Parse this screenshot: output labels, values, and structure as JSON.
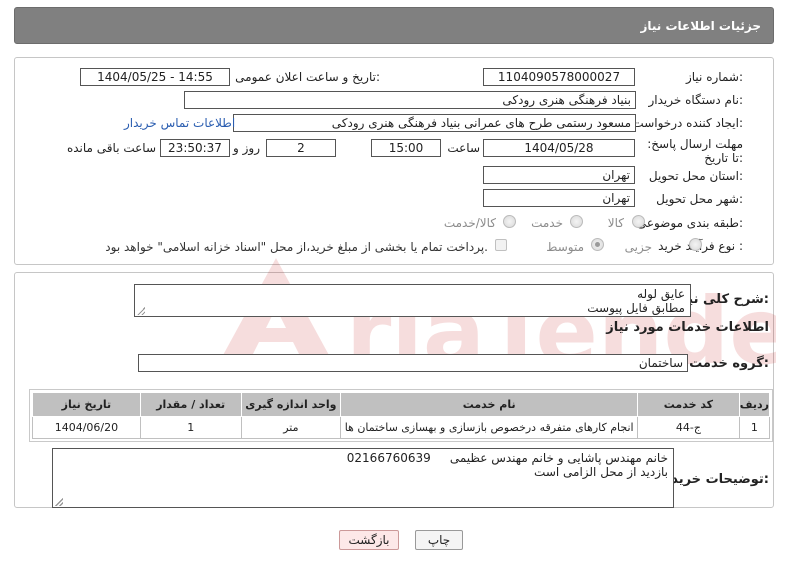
{
  "header": {
    "title": "جزئیات اطلاعات نیاز"
  },
  "form": {
    "need_number_label": "شماره نیاز:",
    "need_number": "1104090578000027",
    "announce_label": "تاریخ و ساعت اعلان عمومی:",
    "announce_value": "1404/05/25 - 14:55",
    "buyer_org_label": "نام دستگاه خریدار:",
    "buyer_org": "بنیاد فرهنگی هنری رودکی",
    "creator_label": "ایجاد کننده درخواست:",
    "creator": "مسعود رستمی طرح های عمرانی بنیاد فرهنگی هنری رودکی",
    "contact_link": "اطلاعات تماس خریدار",
    "deadline_label": "مهلت ارسال پاسخ: تا تاریخ:",
    "deadline_date": "1404/05/28",
    "time_label": "ساعت",
    "deadline_time": "15:00",
    "days_value": "2",
    "days_label": "روز و",
    "remaining_value": "23:50:37",
    "remaining_label": "ساعت باقی مانده",
    "province_label": "استان محل تحویل:",
    "province": "تهران",
    "city_label": "شهر محل تحویل:",
    "city": "تهران",
    "category_label": "طبقه بندی موضوعی:",
    "category_options": [
      "کالا",
      "خدمت",
      "کالا/خدمت"
    ],
    "process_label": "نوع فرآیند خرید :",
    "process_options": [
      "جزیی",
      "متوسط"
    ],
    "payment_note": "پرداخت تمام یا بخشی از مبلغ خرید،از محل \"اسناد خزانه اسلامی\" خواهد بود."
  },
  "summary": {
    "label": "شرح کلی نیاز:",
    "lines": [
      "عایق لوله",
      "مطابق فایل پیوست"
    ]
  },
  "services": {
    "section_title": "اطلاعات خدمات مورد نیاز",
    "group_label": "گروه خدمت:",
    "group_value": "ساختمان",
    "columns": [
      "ردیف",
      "کد خدمت",
      "نام خدمت",
      "واحد اندازه گیری",
      "تعداد / مقدار",
      "تاریخ نیاز"
    ],
    "rows": [
      [
        "1",
        "ج-44",
        "انجام کارهای متفرقه درخصوص بازسازی و بهسازی ساختمان ها",
        "متر",
        "1",
        "1404/06/20"
      ]
    ]
  },
  "buyer_notes": {
    "label": "توضیحات خریدار:",
    "lines": [
      "خانم مهندس پاشایی و خانم مهندس عظیمی     02166760639",
      "بازدید از محل الزامی است"
    ]
  },
  "buttons": {
    "print": "چاپ",
    "back": "بازگشت"
  },
  "colors": {
    "header_bg": "#808080",
    "table_header_bg": "#c0c0c0",
    "link": "#2a5db0",
    "back_button_bg": "#fde8e8"
  }
}
